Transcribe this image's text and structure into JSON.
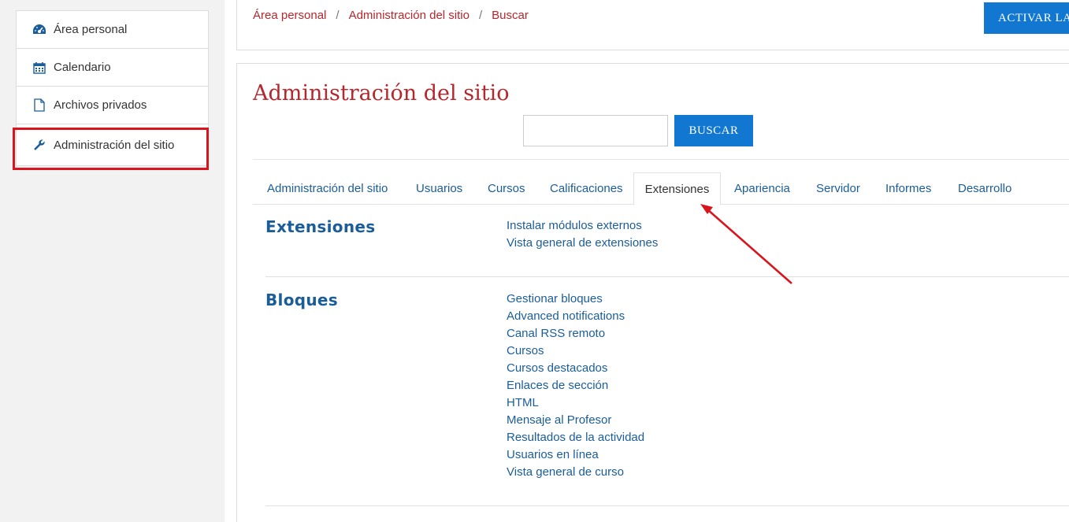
{
  "sidebar": {
    "items": [
      {
        "label": "Área personal",
        "icon": "dashboard-icon"
      },
      {
        "label": "Calendario",
        "icon": "calendar-icon"
      },
      {
        "label": "Archivos privados",
        "icon": "file-icon"
      },
      {
        "label": "Administración del sitio",
        "icon": "wrench-icon"
      }
    ]
  },
  "breadcrumb": {
    "items": [
      "Área personal",
      "Administración del sitio",
      "Buscar"
    ],
    "separator": "/"
  },
  "header": {
    "activate_label": "ACTIVAR LA"
  },
  "main": {
    "title": "Administración del sitio",
    "search": {
      "value": "",
      "button_label": "BUSCAR"
    },
    "tabs": [
      {
        "label": "Administración del sitio",
        "active": false
      },
      {
        "label": "Usuarios",
        "active": false
      },
      {
        "label": "Cursos",
        "active": false
      },
      {
        "label": "Calificaciones",
        "active": false
      },
      {
        "label": "Extensiones",
        "active": true
      },
      {
        "label": "Apariencia",
        "active": false
      },
      {
        "label": "Servidor",
        "active": false
      },
      {
        "label": "Informes",
        "active": false
      },
      {
        "label": "Desarrollo",
        "active": false
      }
    ],
    "sections": [
      {
        "title": "Extensiones",
        "links": [
          "Instalar módulos externos",
          "Vista general de extensiones"
        ]
      },
      {
        "title": "Bloques",
        "links": [
          "Gestionar bloques",
          "Advanced notifications",
          "Canal RSS remoto",
          "Cursos",
          "Cursos destacados",
          "Enlaces de sección",
          "HTML",
          "Mensaje al Profesor",
          "Resultados de la actividad",
          "Usuarios en línea",
          "Vista general de curso"
        ]
      }
    ]
  },
  "colors": {
    "accent": "#1177d1",
    "brand_red": "#b5272d",
    "link": "#1a5d98",
    "annotation": "#d9141c"
  }
}
